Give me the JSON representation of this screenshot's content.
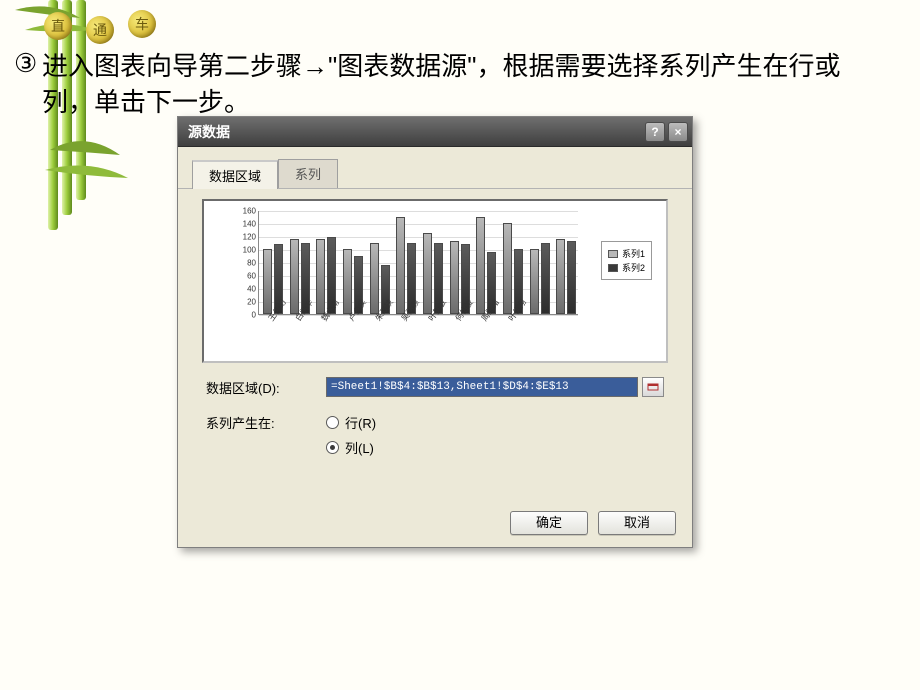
{
  "decor": {
    "coins": [
      "直",
      "通",
      "车"
    ],
    "step_num": "③",
    "step_text": "进入图表向导第二步骤→\"图表数据源\"，根据需要选择系列产生在行或列，单击下一步。"
  },
  "dialog": {
    "title": "源数据",
    "help": "?",
    "close": "×",
    "tabs": {
      "data_range": "数据区域",
      "series": "系列"
    },
    "labels": {
      "range": "数据区域(D):",
      "series_in": "系列产生在:",
      "row": "行(R)",
      "col": "列(L)"
    },
    "range_value": "=Sheet1!$B$4:$B$13,Sheet1!$D$4:$E$13",
    "series_selected": "col",
    "legend": {
      "s1": "系列1",
      "s2": "系列2"
    },
    "buttons": {
      "ok": "确定",
      "cancel": "取消"
    }
  },
  "chart_data": {
    "type": "bar",
    "yticks": [
      0,
      20,
      40,
      60,
      80,
      100,
      120,
      140,
      160
    ],
    "ylim": [
      0,
      160
    ],
    "categories": [
      "王俊幻",
      "白凯辛",
      "魏水南",
      "卢乡侯",
      "朱政硖",
      "吴丽颖",
      "叶梦敏",
      "何怡俊",
      "周胞绪",
      "叶优翔"
    ],
    "series": [
      {
        "name": "系列1",
        "values": [
          100,
          115,
          115,
          100,
          110,
          150,
          125,
          112,
          150,
          140,
          100,
          115
        ]
      },
      {
        "name": "系列2",
        "values": [
          108,
          110,
          118,
          90,
          75,
          110,
          110,
          108,
          95,
          100,
          110,
          112
        ]
      }
    ],
    "title": "",
    "xlabel": "",
    "ylabel": ""
  }
}
